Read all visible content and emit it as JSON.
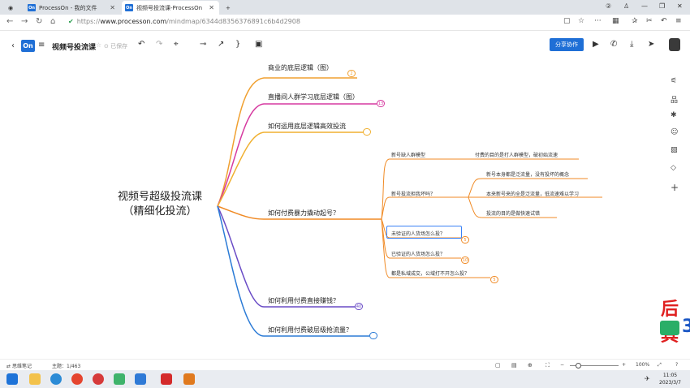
{
  "browser": {
    "tabs": [
      {
        "favicon": "On",
        "label": "ProcessOn - 我的文件"
      },
      {
        "favicon": "On",
        "label": "视频号投流课-ProcessOn"
      }
    ],
    "new_tab": "+",
    "url_prefix": "https://",
    "url_host": "www.processon.com",
    "url_path": "/mindmap/6344d8356376891c6b4d2908"
  },
  "toolbar": {
    "logo": "On",
    "doc_title": "视频号投流课",
    "saved_status": "已保存",
    "share_label": "分享协作"
  },
  "mindmap": {
    "root": [
      "视频号超级投流课",
      "（精细化投流）"
    ],
    "branches": [
      {
        "label": "商业的底层逻辑（图）",
        "badge": "2",
        "color": "#f0a030"
      },
      {
        "label": "直播间人群学习底层逻辑（图）",
        "badge": "13",
        "color": "#d63aa0"
      },
      {
        "label": "如何运用底层逻辑高效投流",
        "badge": "",
        "color": "#f0b030"
      },
      {
        "label": "如何付费暴力撬动起号？",
        "badge": "",
        "color": "#f08a24"
      },
      {
        "label": "如何利用付费直接赚钱？",
        "badge": "40",
        "color": "#6a4cc6"
      },
      {
        "label": "如何利用付费破层级抢流量？",
        "badge": "",
        "color": "#2b7bd6"
      }
    ],
    "sub": [
      {
        "label": "新号缺人群模型",
        "badge": ""
      },
      {
        "label": "新号投流担我坏吗？",
        "badge": ""
      },
      {
        "label": "未验证的人货场怎么投？",
        "badge": "5"
      },
      {
        "label": "已验证的人货场怎么投？",
        "badge": "10"
      },
      {
        "label": "都是私域成交，公域打不开怎么投？",
        "badge": "5"
      }
    ],
    "leaves": [
      {
        "label": "付费的目的是打人群模型，破初始流速"
      },
      {
        "label": "新号本身都是泛流量，没有投坏的概念"
      },
      {
        "label": "本来新号来的全是泛流量，低流速难以学习"
      },
      {
        "label": "投流的目的是做快速试错"
      }
    ]
  },
  "right_panel": [
    "sliders-icon",
    "sitemap-icon",
    "tag-icon",
    "smile-icon",
    "image-icon",
    "label-icon",
    "plus-icon"
  ],
  "overlay": {
    "text": "后其",
    "number": "3"
  },
  "status": {
    "mode": "思维笔记",
    "topic_label": "主题：",
    "topic_count": "1/463",
    "zoom": "100%"
  },
  "clock": {
    "time": "11:05",
    "date": "2023/3/7"
  }
}
